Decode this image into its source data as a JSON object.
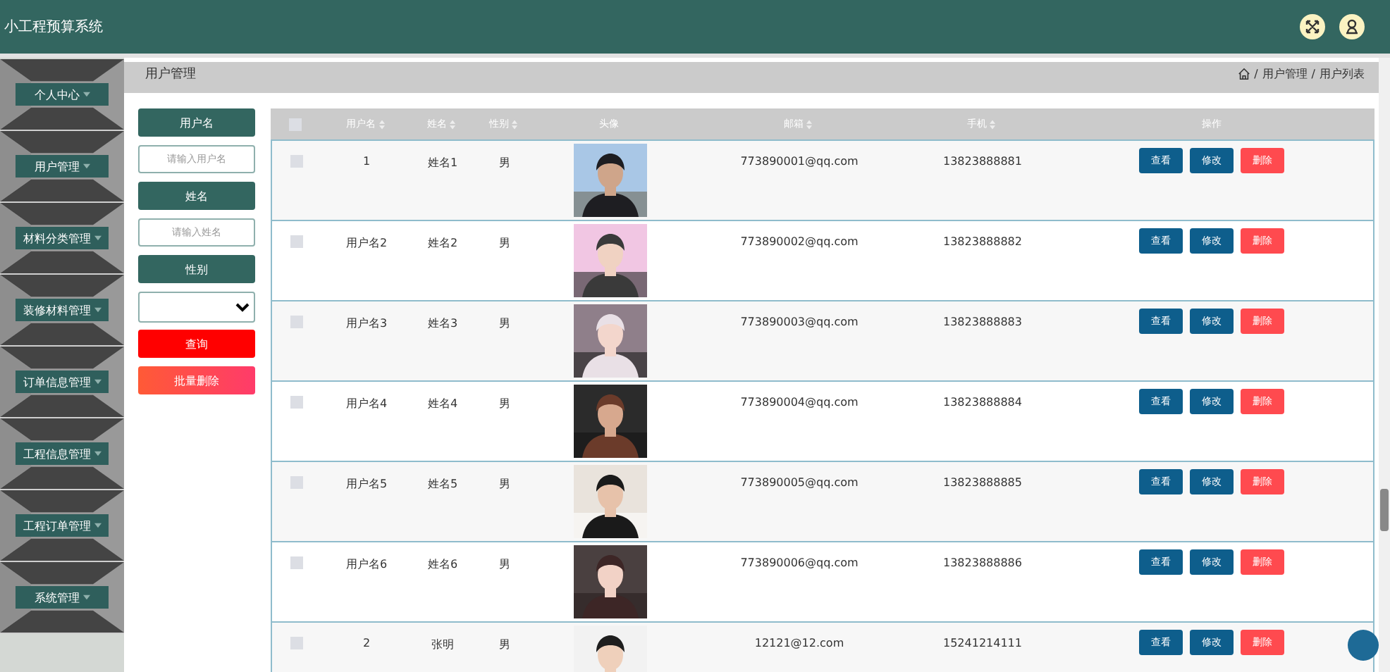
{
  "header": {
    "title": "小工程预算系统"
  },
  "sidebar": {
    "items": [
      {
        "label": "个人中心"
      },
      {
        "label": "用户管理"
      },
      {
        "label": "材料分类管理"
      },
      {
        "label": "装修材料管理"
      },
      {
        "label": "订单信息管理"
      },
      {
        "label": "工程信息管理"
      },
      {
        "label": "工程订单管理"
      },
      {
        "label": "系统管理"
      }
    ]
  },
  "page_title": "用户管理",
  "breadcrumb": {
    "separator": "/",
    "items": [
      "用户管理",
      "用户列表"
    ]
  },
  "search": {
    "fields": [
      {
        "kind": "text",
        "label": "用户名",
        "placeholder": "请输入用户名"
      },
      {
        "kind": "text",
        "label": "姓名",
        "placeholder": "请输入姓名"
      },
      {
        "kind": "select",
        "label": "性别"
      }
    ],
    "query_button": "查询",
    "batch_delete_button": "批量删除"
  },
  "table": {
    "select_all_checked": false,
    "columns": [
      {
        "label": "用户名",
        "sortable": true
      },
      {
        "label": "姓名",
        "sortable": true
      },
      {
        "label": "性别",
        "sortable": true
      },
      {
        "label": "头像",
        "sortable": false
      },
      {
        "label": "邮箱",
        "sortable": true
      },
      {
        "label": "手机",
        "sortable": true
      },
      {
        "label": "操作",
        "sortable": false
      }
    ],
    "rows": [
      {
        "username": "1",
        "name": "姓名1",
        "gender": "男",
        "email": "773890001@qq.com",
        "phone": "13823888881",
        "checked": false,
        "actions": [
          {
            "kind": "view",
            "label": "查看"
          },
          {
            "kind": "edit",
            "label": "修改"
          },
          {
            "kind": "delete",
            "label": "删除"
          }
        ]
      },
      {
        "username": "用户名2",
        "name": "姓名2",
        "gender": "男",
        "email": "773890002@qq.com",
        "phone": "13823888882",
        "checked": false,
        "actions": [
          {
            "kind": "view",
            "label": "查看"
          },
          {
            "kind": "edit",
            "label": "修改"
          },
          {
            "kind": "delete",
            "label": "删除"
          }
        ]
      },
      {
        "username": "用户名3",
        "name": "姓名3",
        "gender": "男",
        "email": "773890003@qq.com",
        "phone": "13823888883",
        "checked": false,
        "actions": [
          {
            "kind": "view",
            "label": "查看"
          },
          {
            "kind": "edit",
            "label": "修改"
          },
          {
            "kind": "delete",
            "label": "删除"
          }
        ]
      },
      {
        "username": "用户名4",
        "name": "姓名4",
        "gender": "男",
        "email": "773890004@qq.com",
        "phone": "13823888884",
        "checked": false,
        "actions": [
          {
            "kind": "view",
            "label": "查看"
          },
          {
            "kind": "edit",
            "label": "修改"
          },
          {
            "kind": "delete",
            "label": "删除"
          }
        ]
      },
      {
        "username": "用户名5",
        "name": "姓名5",
        "gender": "男",
        "email": "773890005@qq.com",
        "phone": "13823888885",
        "checked": false,
        "actions": [
          {
            "kind": "view",
            "label": "查看"
          },
          {
            "kind": "edit",
            "label": "修改"
          },
          {
            "kind": "delete",
            "label": "删除"
          }
        ]
      },
      {
        "username": "用户名6",
        "name": "姓名6",
        "gender": "男",
        "email": "773890006@qq.com",
        "phone": "13823888886",
        "checked": false,
        "actions": [
          {
            "kind": "view",
            "label": "查看"
          },
          {
            "kind": "edit",
            "label": "修改"
          },
          {
            "kind": "delete",
            "label": "删除"
          }
        ]
      },
      {
        "username": "2",
        "name": "张明",
        "gender": "男",
        "email": "12121@12.com",
        "phone": "15241214111",
        "checked": false,
        "actions": [
          {
            "kind": "view",
            "label": "查看"
          },
          {
            "kind": "edit",
            "label": "修改"
          },
          {
            "kind": "delete",
            "label": "删除"
          }
        ]
      }
    ]
  }
}
